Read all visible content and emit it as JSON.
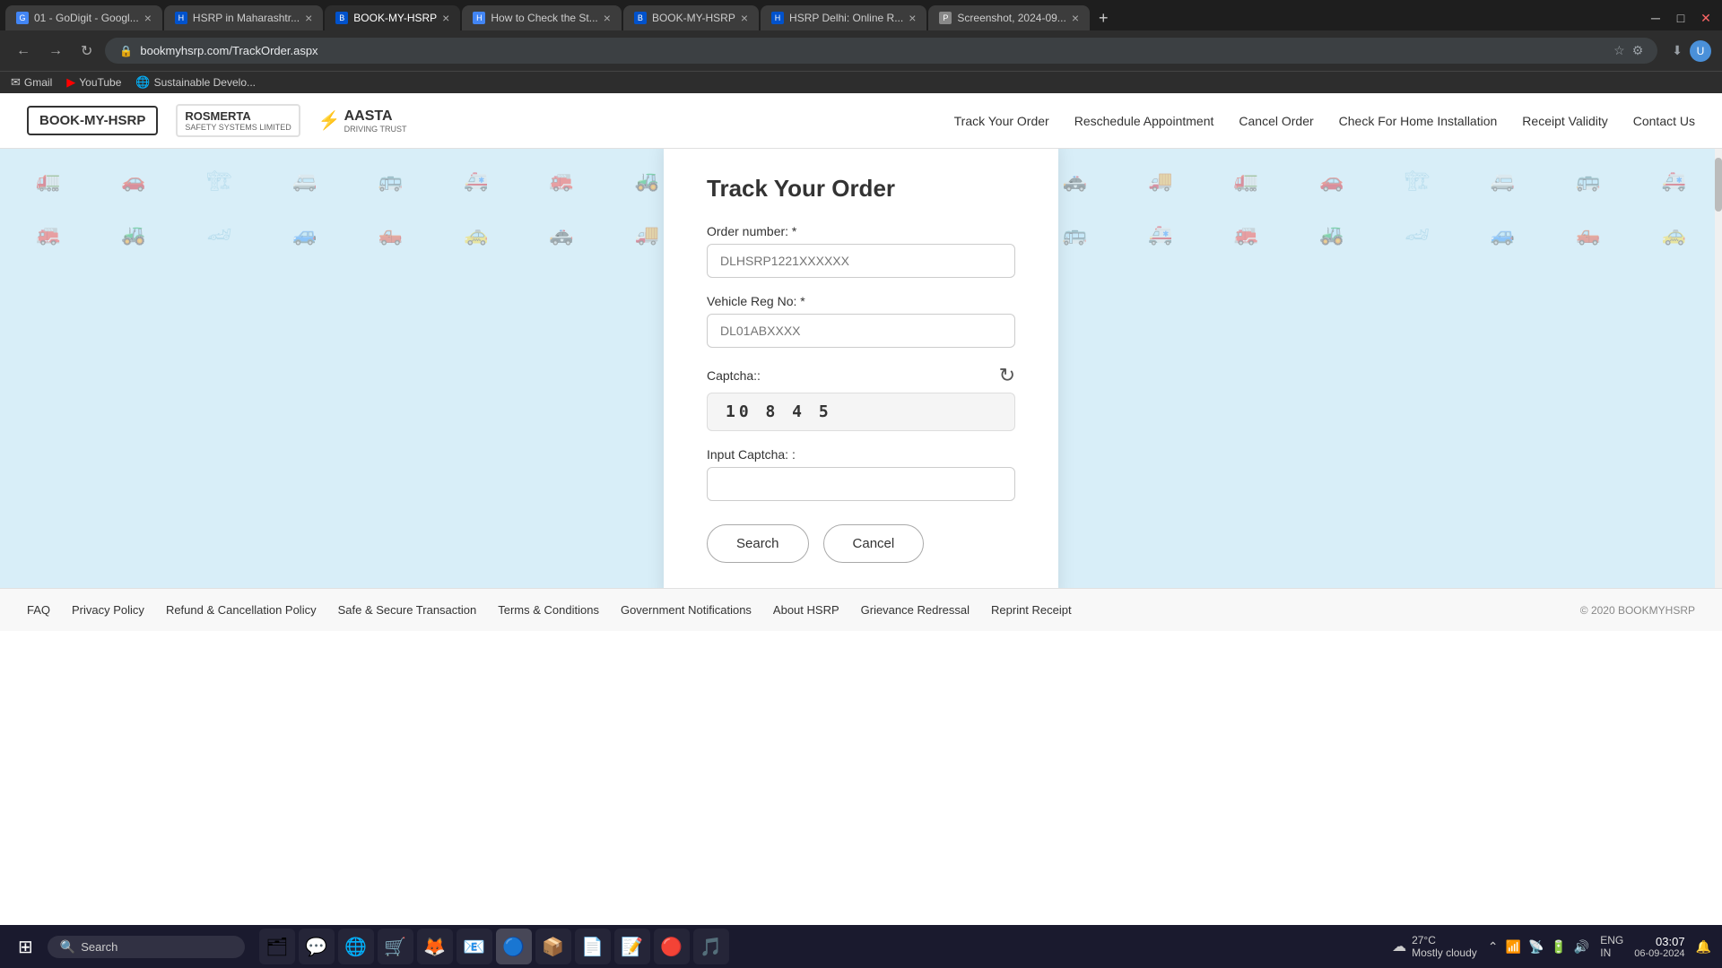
{
  "browser": {
    "tabs": [
      {
        "id": 1,
        "title": "01 - GoDigit - Googl...",
        "favicon": "G",
        "favicon_color": "#4285f4",
        "active": false,
        "closable": true
      },
      {
        "id": 2,
        "title": "HSRP in Maharashtr...",
        "favicon": "H",
        "favicon_color": "#0052cc",
        "active": false,
        "closable": true
      },
      {
        "id": 3,
        "title": "BOOK-MY-HSRP",
        "favicon": "B",
        "favicon_color": "#0052cc",
        "active": true,
        "closable": true
      },
      {
        "id": 4,
        "title": "How to Check the St...",
        "favicon": "H",
        "favicon_color": "#4285f4",
        "active": false,
        "closable": true
      },
      {
        "id": 5,
        "title": "BOOK-MY-HSRP",
        "favicon": "B",
        "favicon_color": "#0052cc",
        "active": false,
        "closable": true
      },
      {
        "id": 6,
        "title": "HSRP Delhi: Online R...",
        "favicon": "H",
        "favicon_color": "#0052cc",
        "active": false,
        "closable": true
      },
      {
        "id": 7,
        "title": "Screenshot, 2024-09...",
        "favicon": "P",
        "favicon_color": "#888",
        "active": false,
        "closable": true
      }
    ],
    "url": "bookmyhsrp.com/TrackOrder.aspx",
    "bookmarks": [
      {
        "label": "Gmail",
        "icon": "✉"
      },
      {
        "label": "YouTube",
        "icon": "▶"
      },
      {
        "label": "Sustainable Develo...",
        "icon": "🌐"
      }
    ]
  },
  "header": {
    "logos": {
      "bookmyhsrp": "BOOK-MY-HSRP",
      "rosmerta": "ROSMERTA",
      "rosmerta_sub": "SAFETY SYSTEMS LIMITED",
      "aasta": "AASTA",
      "aasta_sub": "DRIVING TRUST"
    },
    "nav_items": [
      "Track Your Order",
      "Reschedule Appointment",
      "Cancel Order",
      "Check For Home Installation",
      "Receipt Validity",
      "Contact Us"
    ]
  },
  "form": {
    "title": "Track Your Order",
    "order_number_label": "Order number: *",
    "order_number_placeholder": "DLHSRP1221XXXXXX",
    "vehicle_reg_label": "Vehicle Reg No: *",
    "vehicle_reg_placeholder": "DL01ABXXXX",
    "captcha_label": "Captcha::",
    "captcha_value": "10 8  4 5",
    "input_captcha_label": "Input Captcha: :",
    "input_captcha_value": "",
    "search_button": "Search",
    "cancel_button": "Cancel"
  },
  "footer": {
    "links": [
      "FAQ",
      "Privacy Policy",
      "Refund & Cancellation Policy",
      "Safe & Secure Transaction",
      "Terms & Conditions",
      "Government Notifications",
      "About HSRP",
      "Grievance Redressal",
      "Reprint Receipt"
    ],
    "copyright": "© 2020 BOOKMYHSRP"
  },
  "taskbar": {
    "search_placeholder": "Search",
    "weather_temp": "27°C",
    "weather_desc": "Mostly cloudy",
    "time": "03:07",
    "date": "06-09-2024",
    "language": "ENG\nIN",
    "apps": [
      "🗂",
      "💬",
      "🌐",
      "🛒",
      "🦊",
      "📧",
      "🔵",
      "📦",
      "📄",
      "📝",
      "🔴",
      "🎵"
    ]
  },
  "colors": {
    "accent": "#4a90d9",
    "background_light_blue": "#d8eef8",
    "header_border": "#e0e0e0",
    "nav_text": "#333333",
    "footer_bg": "#f8f8f8",
    "taskbar_bg": "#1a1a2e"
  },
  "vehicles": [
    "🚛",
    "🚗",
    "🏗",
    "🚐",
    "🚌",
    "🚑",
    "🚒",
    "🚜",
    "🏎",
    "🚙",
    "🛻",
    "🚕",
    "🚓",
    "🚚"
  ]
}
